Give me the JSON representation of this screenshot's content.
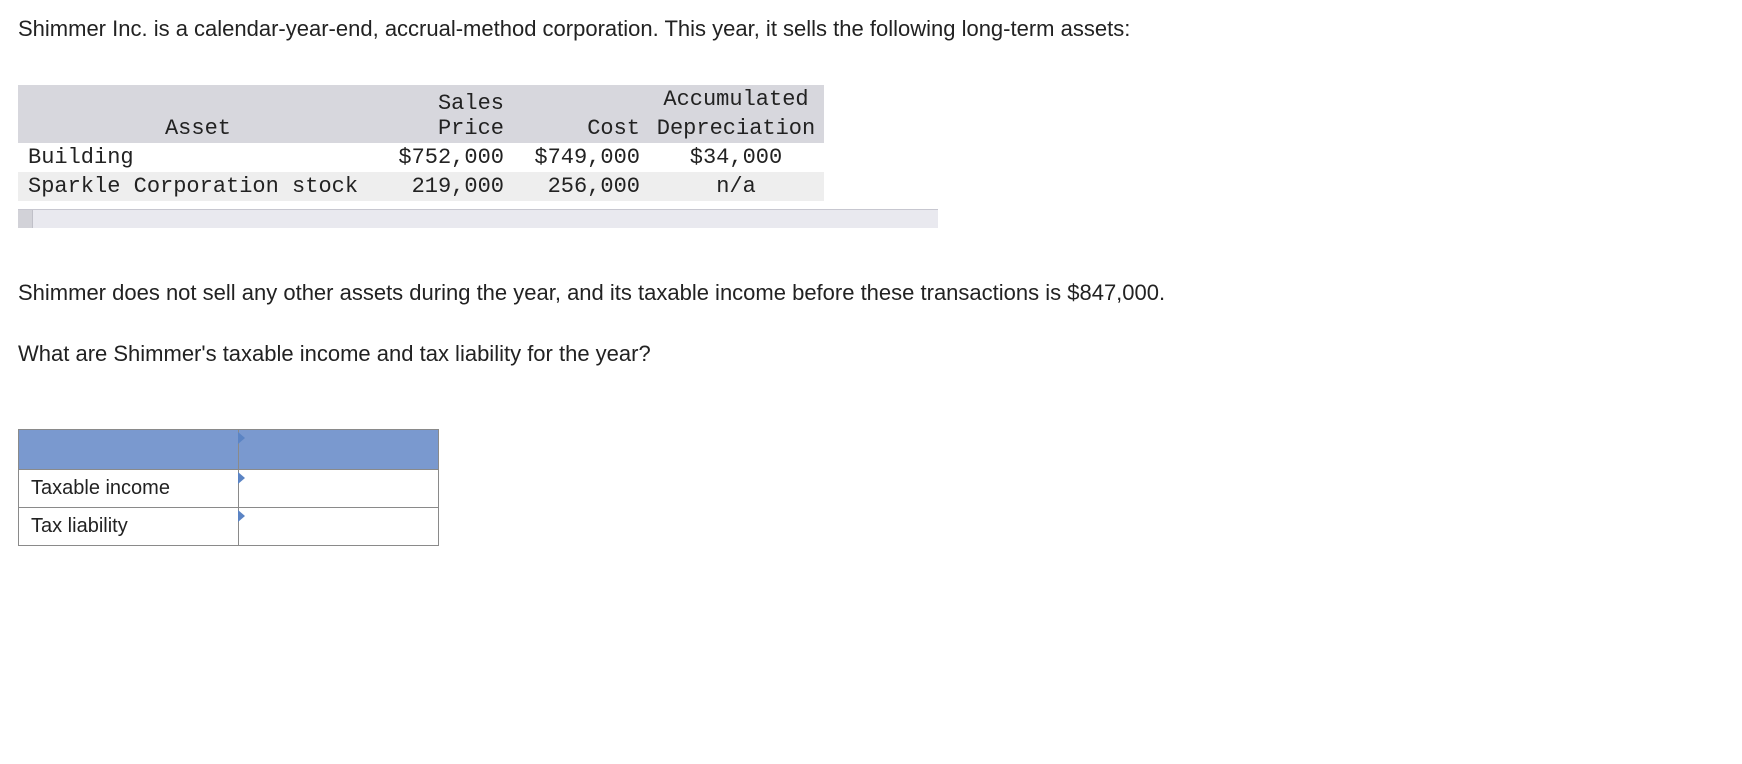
{
  "intro_line1": "Shimmer Inc. is a calendar-year-end, accrual-method corporation. This year, it sells the following long-term assets:",
  "asset_table": {
    "headers": {
      "asset": "Asset",
      "sales_price": "Sales Price",
      "cost": "Cost",
      "acc_dep_line1": "Accumulated",
      "acc_dep_line2": "Depreciation"
    },
    "rows": [
      {
        "asset": "Building",
        "sales_price": "$752,000",
        "cost": "$749,000",
        "dep": "$34,000"
      },
      {
        "asset": "Sparkle Corporation stock",
        "sales_price": "219,000",
        "cost": "256,000",
        "dep": "n/a"
      }
    ]
  },
  "mid_text1": "Shimmer does not sell any other assets during the year, and its taxable income before these transactions is $847,000.",
  "mid_text2": "What are Shimmer's taxable income and tax liability for the year?",
  "answer": {
    "taxable_income_label": "Taxable income",
    "tax_liability_label": "Tax liability"
  }
}
